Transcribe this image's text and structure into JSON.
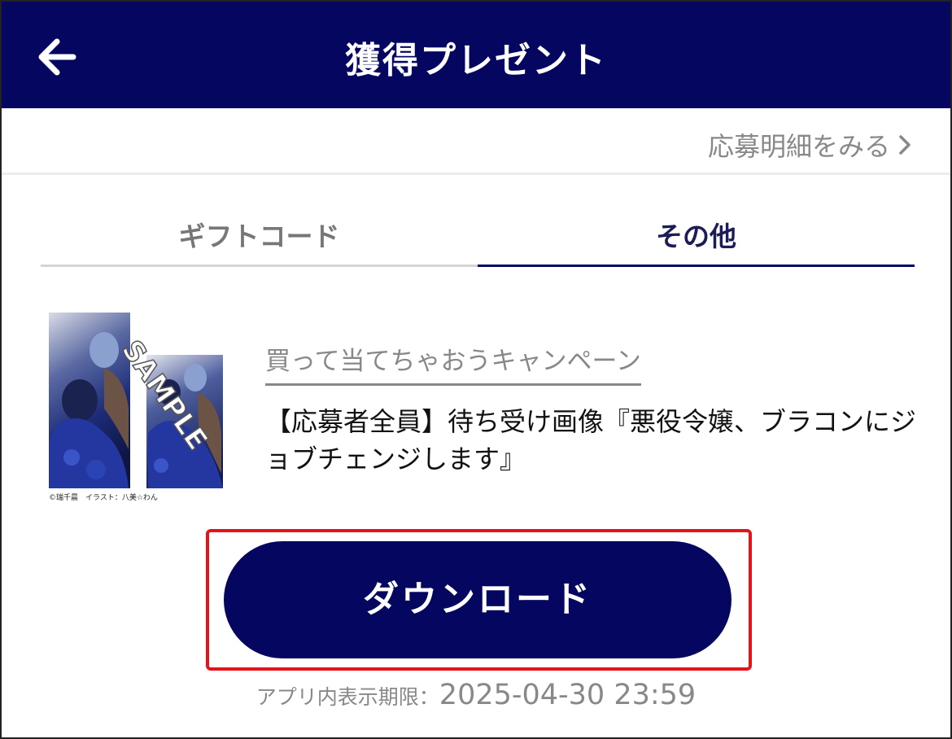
{
  "header": {
    "title": "獲得プレゼント",
    "back_icon": "arrow-left-icon",
    "background": "#05065f"
  },
  "subbar": {
    "detail_link": "応募明細をみる",
    "chevron_icon": "chevron-right-icon"
  },
  "tabs": [
    {
      "label": "ギフトコード",
      "active": false
    },
    {
      "label": "その他",
      "active": true
    }
  ],
  "item": {
    "thumbnail": {
      "watermark": "SAMPLE",
      "credit": "©瑞千晨　イラスト：八美☆わん"
    },
    "campaign_link": "買って当てちゃおうキャンペーン",
    "title": "【応募者全員】待ち受け画像『悪役令嬢、ブラコンにジョブチェンジします』"
  },
  "download": {
    "label": "ダウンロード"
  },
  "expiry": {
    "label": "アプリ内表示期限：",
    "date": "2025-04-30 23:59"
  },
  "colors": {
    "accent": "#05065f",
    "highlight": "#e5141a",
    "muted_text": "#888888"
  }
}
